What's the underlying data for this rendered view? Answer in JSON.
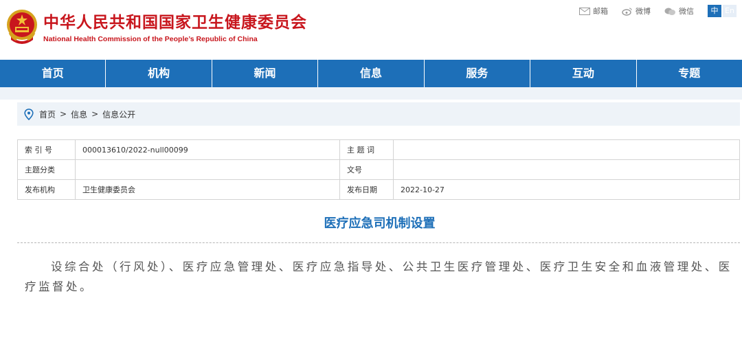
{
  "header": {
    "title": "中华人民共和国国家卫生健康委员会",
    "subtitle": "National Health Commission of the People’s Republic of China",
    "links": [
      {
        "label": "邮箱",
        "icon": "mail-icon"
      },
      {
        "label": "微博",
        "icon": "weibo-icon"
      },
      {
        "label": "微信",
        "icon": "wechat-icon"
      }
    ],
    "lang": {
      "zh": "中",
      "en": "En"
    }
  },
  "nav": {
    "items": [
      "首页",
      "机构",
      "新闻",
      "信息",
      "服务",
      "互动",
      "专题"
    ]
  },
  "breadcrumb": {
    "icon": "location-pin-icon",
    "items": [
      "首页",
      "信息",
      "信息公开"
    ],
    "separator": ">"
  },
  "meta": {
    "index_label": "索 引 号",
    "index_value": "000013610/2022-null00099",
    "keyword_label": "主 题 词",
    "keyword_value": "",
    "category_label": "主题分类",
    "category_value": "",
    "docno_label": "文号",
    "docno_value": "",
    "publisher_label": "发布机构",
    "publisher_value": "卫生健康委员会",
    "date_label": "发布日期",
    "date_value": "2022-10-27"
  },
  "article": {
    "title": "医疗应急司机制设置",
    "body": "设综合处（行风处）、医疗应急管理处、医疗应急指导处、公共卫生医疗管理处、医疗卫生安全和血液管理处、医疗监督处。"
  },
  "colors": {
    "brand_red": "#c8161d",
    "nav_blue": "#1d6fb8",
    "light_bg": "#eef3f8"
  }
}
